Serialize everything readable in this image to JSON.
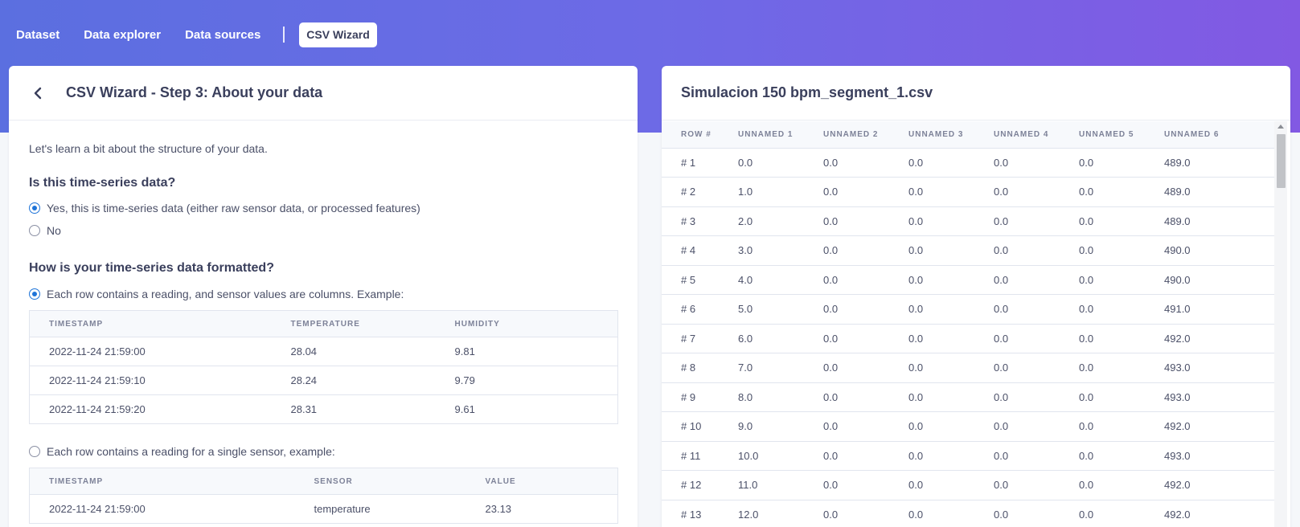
{
  "nav": {
    "items": [
      "Dataset",
      "Data explorer",
      "Data sources"
    ],
    "active": "CSV Wizard"
  },
  "colors": {
    "accent": "#1f74d8",
    "gradient_start": "#5b6fe0",
    "gradient_end": "#8259e3"
  },
  "wizard": {
    "title": "CSV Wizard - Step 3: About your data",
    "intro": "Let's learn a bit about the structure of your data.",
    "q1": {
      "title": "Is this time-series data?",
      "options": [
        {
          "label": "Yes, this is time-series data (either raw sensor data, or processed features)",
          "checked": true
        },
        {
          "label": "No",
          "checked": false
        }
      ]
    },
    "q2": {
      "title": "How is your time-series data formatted?",
      "option1": {
        "label": "Each row contains a reading, and sensor values are columns. Example:",
        "checked": true
      },
      "example1": {
        "headers": [
          "TIMESTAMP",
          "TEMPERATURE",
          "HUMIDITY"
        ],
        "rows": [
          [
            "2022-11-24 21:59:00",
            "28.04",
            "9.81"
          ],
          [
            "2022-11-24 21:59:10",
            "28.24",
            "9.79"
          ],
          [
            "2022-11-24 21:59:20",
            "28.31",
            "9.61"
          ]
        ]
      },
      "option2": {
        "label": "Each row contains a reading for a single sensor, example:",
        "checked": false
      },
      "example2": {
        "headers": [
          "TIMESTAMP",
          "SENSOR",
          "VALUE"
        ],
        "rows": [
          [
            "2022-11-24 21:59:00",
            "temperature",
            "23.13"
          ]
        ]
      }
    }
  },
  "preview": {
    "filename": "Simulacion 150 bpm_segment_1.csv",
    "headers": [
      "ROW #",
      "UNNAMED 1",
      "UNNAMED 2",
      "UNNAMED 3",
      "UNNAMED 4",
      "UNNAMED 5",
      "UNNAMED 6"
    ],
    "rows": [
      [
        "# 1",
        "0.0",
        "0.0",
        "0.0",
        "0.0",
        "0.0",
        "489.0"
      ],
      [
        "# 2",
        "1.0",
        "0.0",
        "0.0",
        "0.0",
        "0.0",
        "489.0"
      ],
      [
        "# 3",
        "2.0",
        "0.0",
        "0.0",
        "0.0",
        "0.0",
        "489.0"
      ],
      [
        "# 4",
        "3.0",
        "0.0",
        "0.0",
        "0.0",
        "0.0",
        "490.0"
      ],
      [
        "# 5",
        "4.0",
        "0.0",
        "0.0",
        "0.0",
        "0.0",
        "490.0"
      ],
      [
        "# 6",
        "5.0",
        "0.0",
        "0.0",
        "0.0",
        "0.0",
        "491.0"
      ],
      [
        "# 7",
        "6.0",
        "0.0",
        "0.0",
        "0.0",
        "0.0",
        "492.0"
      ],
      [
        "# 8",
        "7.0",
        "0.0",
        "0.0",
        "0.0",
        "0.0",
        "493.0"
      ],
      [
        "# 9",
        "8.0",
        "0.0",
        "0.0",
        "0.0",
        "0.0",
        "493.0"
      ],
      [
        "# 10",
        "9.0",
        "0.0",
        "0.0",
        "0.0",
        "0.0",
        "492.0"
      ],
      [
        "# 11",
        "10.0",
        "0.0",
        "0.0",
        "0.0",
        "0.0",
        "493.0"
      ],
      [
        "# 12",
        "11.0",
        "0.0",
        "0.0",
        "0.0",
        "0.0",
        "492.0"
      ],
      [
        "# 13",
        "12.0",
        "0.0",
        "0.0",
        "0.0",
        "0.0",
        "492.0"
      ]
    ]
  }
}
